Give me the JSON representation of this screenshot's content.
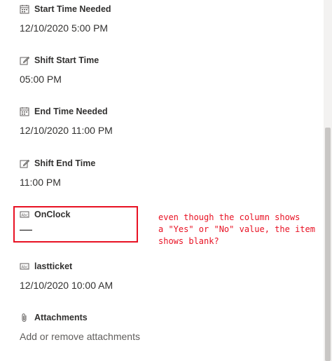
{
  "fields": [
    {
      "label": "Start Time Needed",
      "value": "12/10/2020 5:00 PM",
      "icon": "calendar-icon"
    },
    {
      "label": "Shift Start Time",
      "value": "05:00 PM",
      "icon": "edit-icon"
    },
    {
      "label": "End Time Needed",
      "value": "12/10/2020 11:00 PM",
      "icon": "calendar-icon"
    },
    {
      "label": "Shift End Time",
      "value": "11:00 PM",
      "icon": "edit-icon"
    },
    {
      "label": "OnClock",
      "value": "—",
      "icon": "yes-no-icon"
    },
    {
      "label": "lastticket",
      "value": "12/10/2020 10:00 AM",
      "icon": "text-icon"
    },
    {
      "label": "Attachments",
      "value": "Add or remove attachments",
      "icon": "paperclip-icon"
    }
  ],
  "annotation": {
    "lines": [
      "even though the column shows",
      "a \"Yes\" or \"No\" value, the item",
      "shows blank?"
    ],
    "color": "#e81123"
  },
  "colors": {
    "text": "#323130",
    "highlight": "#e81123",
    "icon": "#605e5c"
  }
}
